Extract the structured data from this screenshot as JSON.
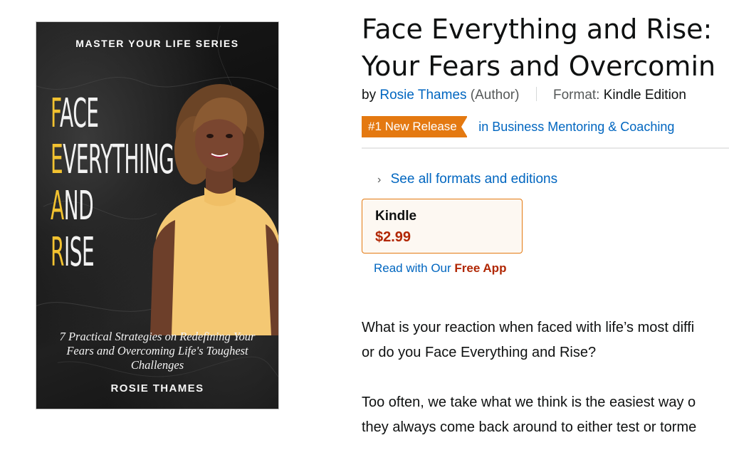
{
  "cover": {
    "series": "MASTER YOUR LIFE SERIES",
    "title_lines": [
      {
        "first": "F",
        "rest": "ACE"
      },
      {
        "first": "E",
        "rest": "VERYTHING"
      },
      {
        "first": "A",
        "rest": "ND"
      },
      {
        "first": "R",
        "rest": "ISE"
      }
    ],
    "subtitle": "7 Practical Strategies on Redefining Your Fears and Overcoming Life's Toughest Challenges",
    "author": "ROSIE THAMES",
    "accent_color": "#f2c230"
  },
  "product": {
    "title_line1": "Face Everything and Rise:",
    "title_line2": "Your Fears and Overcomin",
    "by_label": "by",
    "author": "Rosie Thames",
    "author_role": "(Author)",
    "format_label": "Format:",
    "format_value": "Kindle Edition",
    "badge": "#1 New Release",
    "badge_category": "in Business Mentoring & Coaching",
    "formats_link": "See all formats and editions",
    "format_option": {
      "name": "Kindle",
      "price": "$2.99"
    },
    "read_with": "Read with Our",
    "free_app": "Free App",
    "description": [
      "What is your reaction when faced with life’s most diffi\nor do you Face Everything and Rise?",
      "Too often, we take what we think is the easiest way o\nthey always come back around to either test or torme"
    ]
  },
  "icons": {
    "formats_chevron": "chevron-right-icon"
  },
  "colors": {
    "link": "#0066c0",
    "badge": "#e47911",
    "price": "#b12704"
  }
}
